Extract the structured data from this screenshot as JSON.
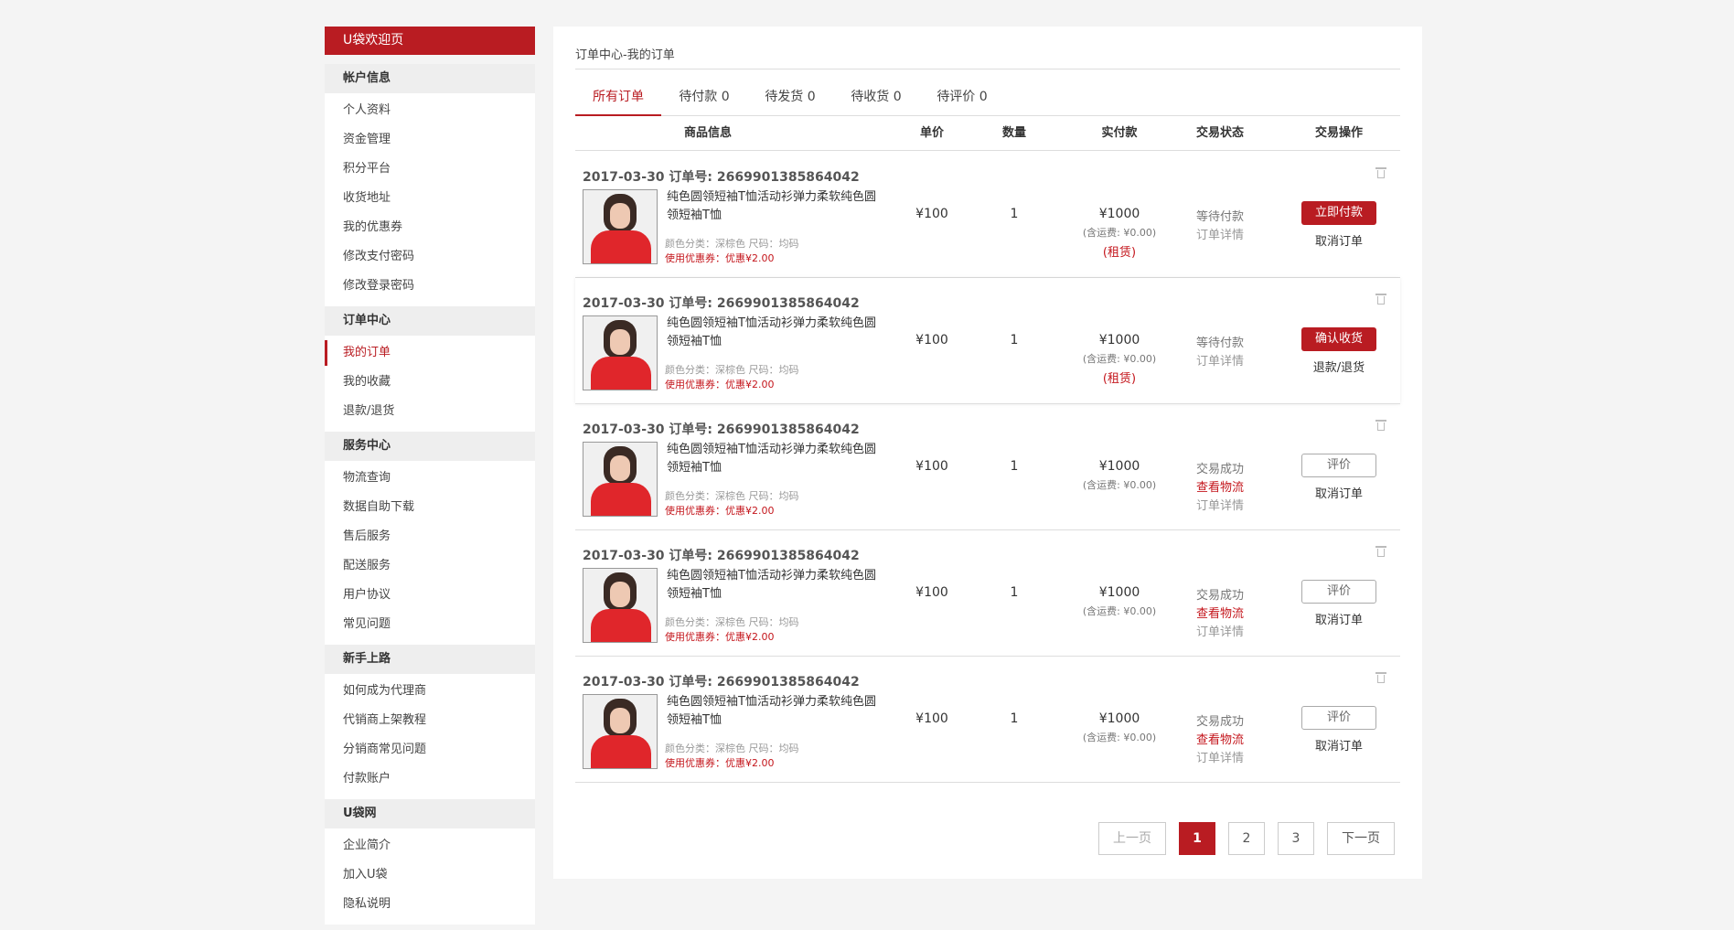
{
  "sidebar": {
    "welcome": "U袋欢迎页",
    "sections": [
      {
        "title": "帐户信息",
        "items": [
          "个人资料",
          "资金管理",
          "积分平台",
          "收货地址",
          "我的优惠券",
          "修改支付密码",
          "修改登录密码"
        ]
      },
      {
        "title": "订单中心",
        "items": [
          "我的订单",
          "我的收藏",
          "退款/退货"
        ]
      },
      {
        "title": "服务中心",
        "items": [
          "物流查询",
          "数据自助下载",
          "售后服务",
          "配送服务",
          "用户协议",
          "常见问题"
        ]
      },
      {
        "title": "新手上路",
        "items": [
          "如何成为代理商",
          "代销商上架教程",
          "分销商常见问题",
          "付款账户"
        ]
      },
      {
        "title": "U袋网",
        "items": [
          "企业简介",
          "加入U袋",
          "隐私说明"
        ]
      }
    ],
    "active_item": "我的订单"
  },
  "breadcrumb": "订单中心-我的订单",
  "tabs": [
    "所有订单",
    "待付款 0",
    "待发货 0",
    "待收货 0",
    "待评价 0"
  ],
  "active_tab": 0,
  "table_headers": {
    "product": "商品信息",
    "price": "单价",
    "qty": "数量",
    "paid": "实付款",
    "status": "交易状态",
    "ops": "交易操作"
  },
  "orders": [
    {
      "date_no": "2017-03-30 订单号: 2669901385864042",
      "name": "纯色圆领短袖T恤活动衫弹力柔软纯色圆领短袖T恤",
      "spec": "颜色分类：深棕色 尺码：均码",
      "coupon": "使用优惠券：优惠¥2.00",
      "price": "¥100",
      "qty": "1",
      "paid": "¥1000",
      "shipping": "(含运费: ¥0.00)",
      "rent": "(租赁)",
      "status": "等待付款",
      "logistics": "",
      "detail": "订单详情",
      "primary": "立即付款",
      "primary_style": "red",
      "secondary": "取消订单"
    },
    {
      "date_no": "2017-03-30 订单号: 2669901385864042",
      "name": "纯色圆领短袖T恤活动衫弹力柔软纯色圆领短袖T恤",
      "spec": "颜色分类：深棕色 尺码：均码",
      "coupon": "使用优惠券：优惠¥2.00",
      "price": "¥100",
      "qty": "1",
      "paid": "¥1000",
      "shipping": "(含运费: ¥0.00)",
      "rent": "(租赁)",
      "status": "等待付款",
      "logistics": "",
      "detail": "订单详情",
      "primary": "确认收货",
      "primary_style": "red",
      "secondary": "退款/退货"
    },
    {
      "date_no": "2017-03-30 订单号: 2669901385864042",
      "name": "纯色圆领短袖T恤活动衫弹力柔软纯色圆领短袖T恤",
      "spec": "颜色分类：深棕色 尺码：均码",
      "coupon": "使用优惠券：优惠¥2.00",
      "price": "¥100",
      "qty": "1",
      "paid": "¥1000",
      "shipping": "(含运费: ¥0.00)",
      "rent": "",
      "status": "交易成功",
      "logistics": "查看物流",
      "detail": "订单详情",
      "primary": "评价",
      "primary_style": "white",
      "secondary": "取消订单"
    },
    {
      "date_no": "2017-03-30 订单号: 2669901385864042",
      "name": "纯色圆领短袖T恤活动衫弹力柔软纯色圆领短袖T恤",
      "spec": "颜色分类：深棕色 尺码：均码",
      "coupon": "使用优惠券：优惠¥2.00",
      "price": "¥100",
      "qty": "1",
      "paid": "¥1000",
      "shipping": "(含运费: ¥0.00)",
      "rent": "",
      "status": "交易成功",
      "logistics": "查看物流",
      "detail": "订单详情",
      "primary": "评价",
      "primary_style": "white",
      "secondary": "取消订单"
    },
    {
      "date_no": "2017-03-30 订单号: 2669901385864042",
      "name": "纯色圆领短袖T恤活动衫弹力柔软纯色圆领短袖T恤",
      "spec": "颜色分类：深棕色 尺码：均码",
      "coupon": "使用优惠券：优惠¥2.00",
      "price": "¥100",
      "qty": "1",
      "paid": "¥1000",
      "shipping": "(含运费: ¥0.00)",
      "rent": "",
      "status": "交易成功",
      "logistics": "查看物流",
      "detail": "订单详情",
      "primary": "评价",
      "primary_style": "white",
      "secondary": "取消订单"
    }
  ],
  "pagination": {
    "prev": "上一页",
    "pages": [
      "1",
      "2",
      "3"
    ],
    "current": "1",
    "next": "下一页"
  },
  "colors": {
    "accent": "#b91c22",
    "background": "#f4f4f4"
  },
  "icons": {
    "delete": "trash-icon",
    "product_image": "red-tshirt-photo"
  }
}
